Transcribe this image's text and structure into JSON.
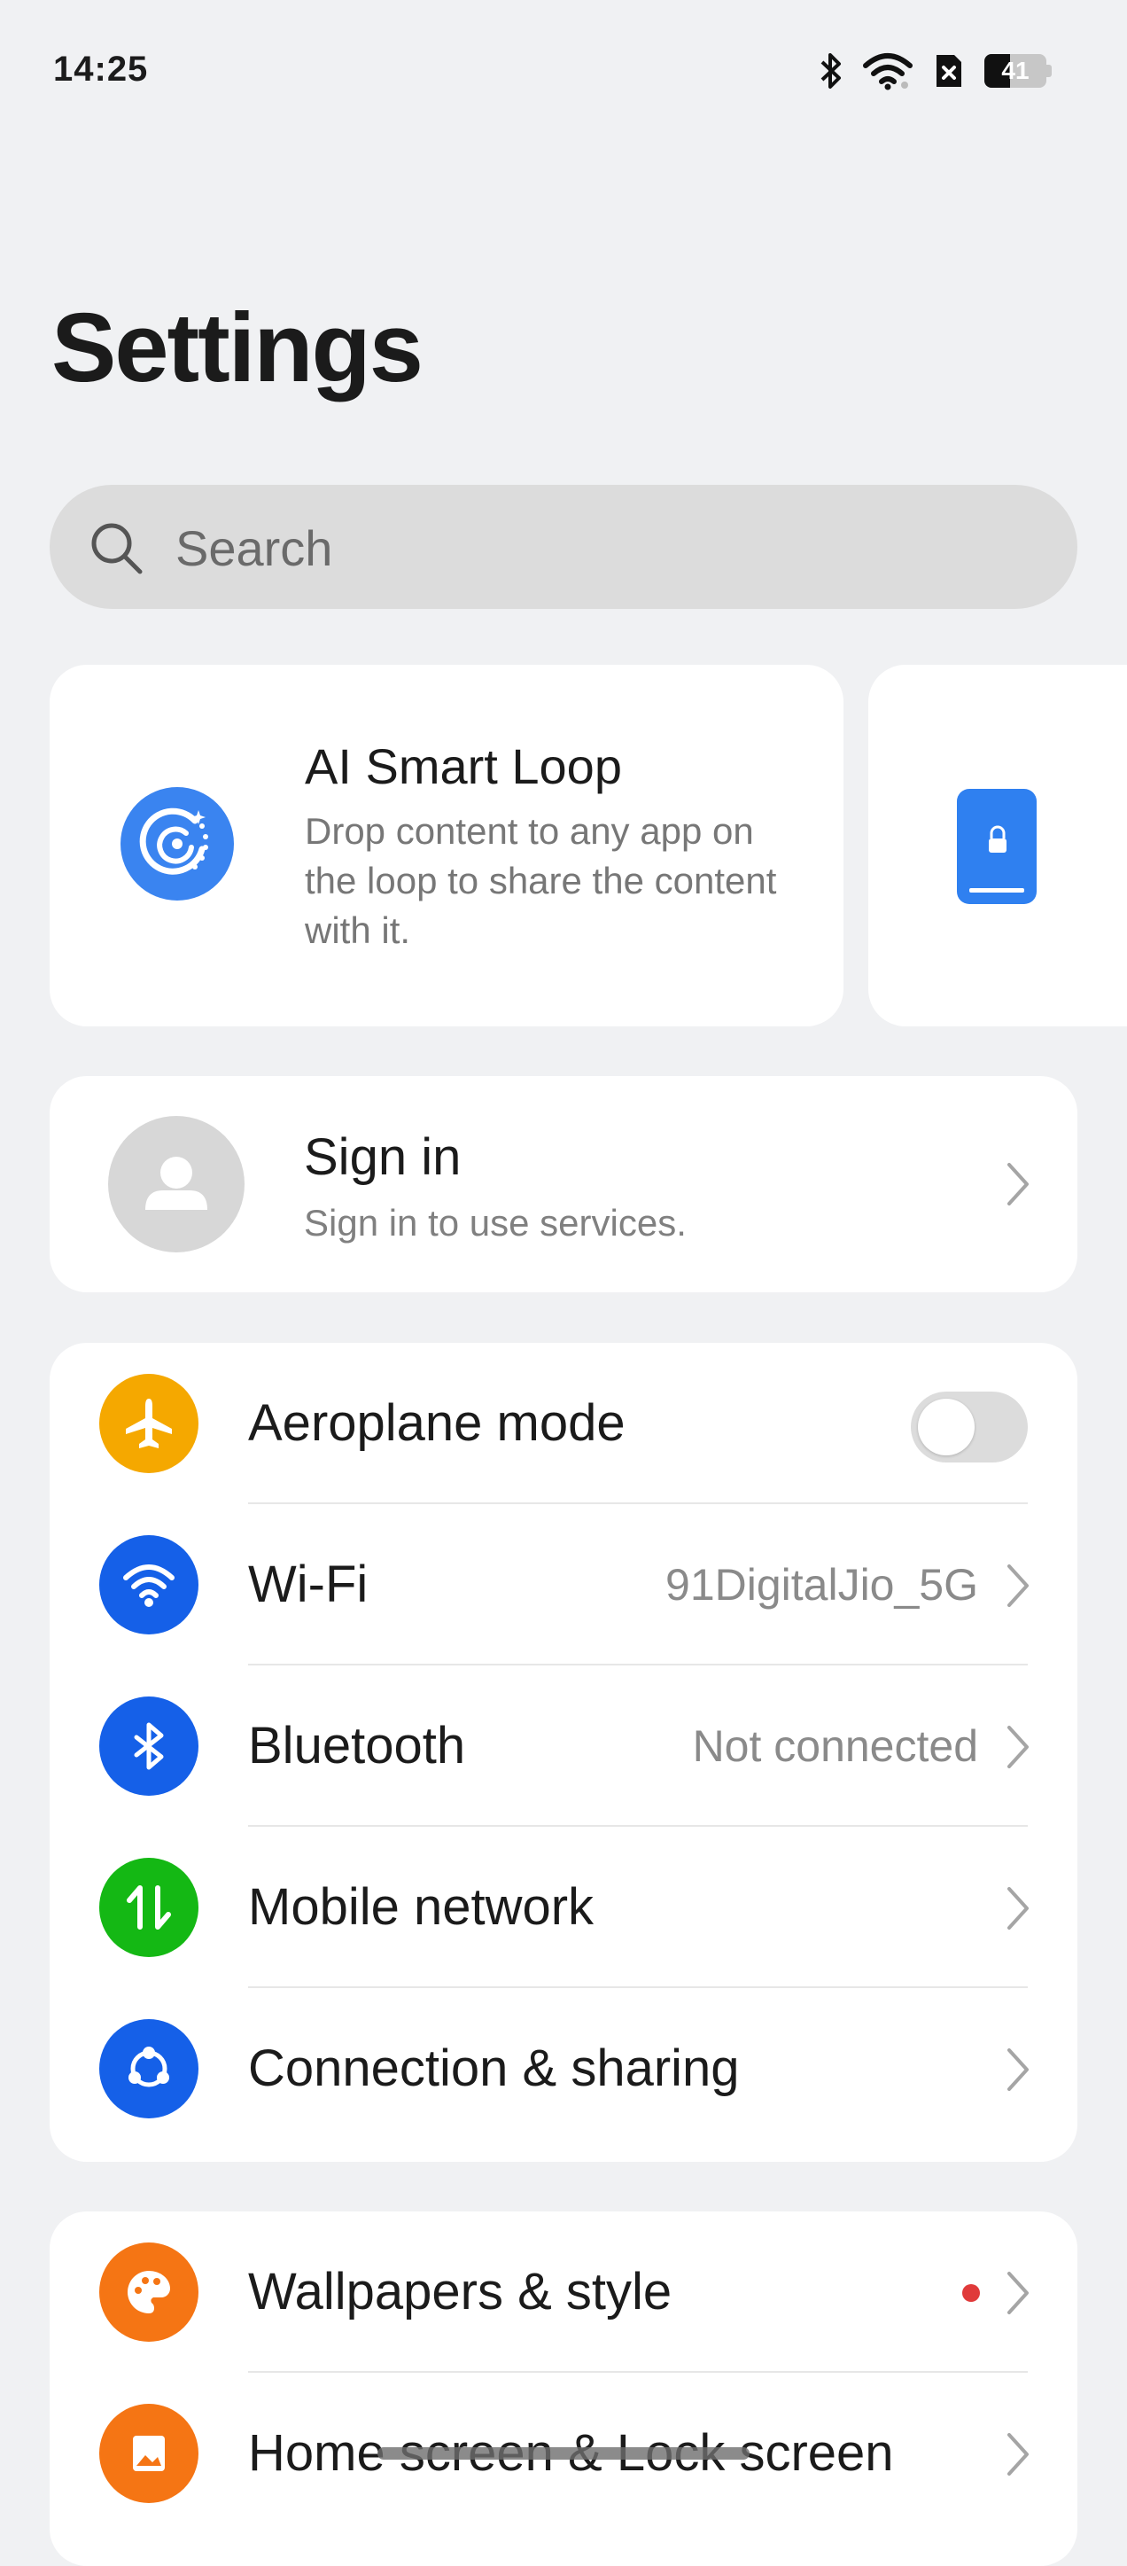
{
  "status_bar": {
    "time": "14:25",
    "battery_level": "41",
    "battery_fraction": 0.41,
    "icons": [
      "bluetooth-icon",
      "wifi-icon",
      "no-sim-icon",
      "battery-icon"
    ]
  },
  "header": {
    "title": "Settings"
  },
  "search": {
    "placeholder": "Search"
  },
  "cards": {
    "smart_loop": {
      "title": "AI Smart Loop",
      "description": "Drop content to any app on the loop to share the content with it.",
      "icon": "smart-loop-icon",
      "icon_color": "#3a84f0"
    },
    "peek": {
      "icon": "phone-lock-icon",
      "icon_color": "#2f80f0"
    }
  },
  "account": {
    "title": "Sign in",
    "subtitle": "Sign in to use services."
  },
  "connectivity": [
    {
      "key": "aeroplane",
      "label": "Aeroplane mode",
      "icon": "airplane-icon",
      "color": "#f5a800",
      "toggle_on": false
    },
    {
      "key": "wifi",
      "label": "Wi-Fi",
      "value": "91DigitalJio_5G",
      "icon": "wifi-icon",
      "color": "#1560e8"
    },
    {
      "key": "bluetooth",
      "label": "Bluetooth",
      "value": "Not connected",
      "icon": "bluetooth-icon",
      "color": "#1560e8"
    },
    {
      "key": "mobile",
      "label": "Mobile network",
      "icon": "mobile-data-icon",
      "color": "#14b814"
    },
    {
      "key": "sharing",
      "label": "Connection & sharing",
      "icon": "share-icon",
      "color": "#1560e8"
    }
  ],
  "personalization": [
    {
      "key": "wallpapers",
      "label": "Wallpapers & style",
      "icon": "palette-icon",
      "color": "#f57514",
      "has_badge": true
    },
    {
      "key": "homescreen",
      "label": "Home screen & Lock screen",
      "icon": "home-screen-icon",
      "color": "#f57514"
    }
  ]
}
